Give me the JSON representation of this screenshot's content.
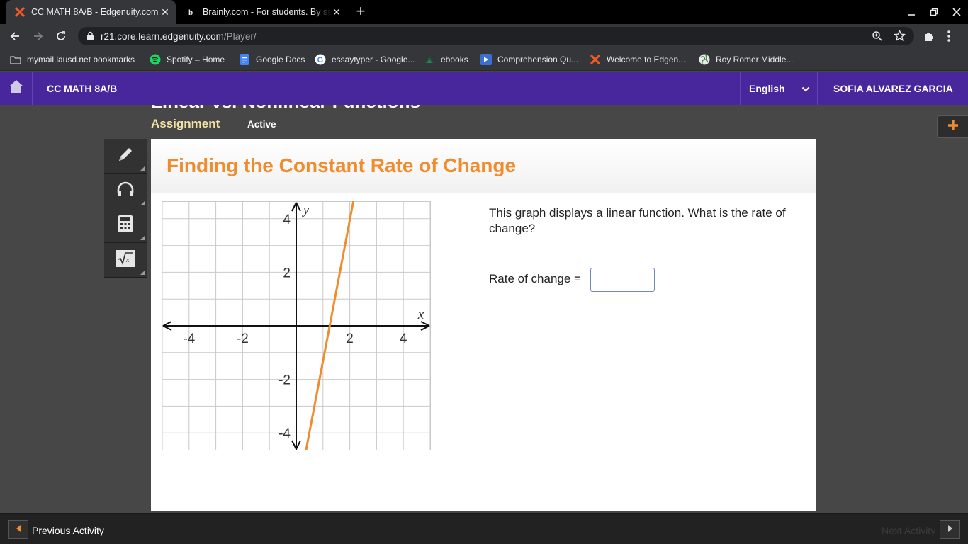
{
  "browser": {
    "tabs": [
      {
        "title": "CC MATH 8A/B - Edgenuity.com",
        "active": true,
        "favicon": "edgenuity-icon"
      },
      {
        "title": "Brainly.com - For students. By students.",
        "active": false,
        "favicon": "brainly-icon"
      }
    ],
    "address": {
      "host": "r21.core.learn.edgenuity.com",
      "path": "/Player/"
    },
    "bookmarks": [
      {
        "label": "mymail.lausd.net bookmarks",
        "icon": "folder-icon"
      },
      {
        "label": "Spotify – Home",
        "icon": "spotify-icon"
      },
      {
        "label": "Google Docs",
        "icon": "google-docs-icon"
      },
      {
        "label": "essaytyper - Google...",
        "icon": "google-icon"
      },
      {
        "label": "ebooks",
        "icon": "ebooks-icon"
      },
      {
        "label": "Comprehension Qu...",
        "icon": "docs-icon"
      },
      {
        "label": "Welcome to Edgen...",
        "icon": "edgenuity-icon"
      },
      {
        "label": "Roy Romer Middle...",
        "icon": "globe-icon"
      }
    ]
  },
  "app": {
    "course": "CC MATH 8A/B",
    "language": "English",
    "user": "SOFIA ALVAREZ GARCIA",
    "lesson_title": "Linear vs. Nonlinear Functions",
    "assignment_label": "Assignment",
    "status": "Active",
    "activity_title": "Finding the Constant Rate of Change",
    "question": "This graph displays a linear function. What is the rate of change?",
    "answer_label": "Rate of change =",
    "answer_value": ""
  },
  "chart_data": {
    "type": "line",
    "xlabel": "x",
    "ylabel": "y",
    "xlim": [
      -5,
      5
    ],
    "ylim": [
      -5,
      5
    ],
    "xticks": [
      -4,
      -2,
      2,
      4
    ],
    "yticks": [
      4,
      2,
      -2,
      -4
    ],
    "grid": true,
    "series": [
      {
        "x": [
          0.3,
          2.2
        ],
        "y": [
          -5,
          5
        ],
        "color": "#f08c2e"
      }
    ]
  },
  "footer": {
    "prev_label": "Previous Activity",
    "next_label": "Next Activity"
  }
}
